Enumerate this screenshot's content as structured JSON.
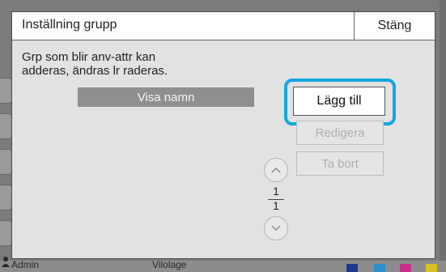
{
  "dialog": {
    "title": "Inställning grupp",
    "close_label": "Stäng",
    "description_line1": "Grp som blir anv-attr kan",
    "description_line2": "adderas, ändras lr raderas.",
    "list_header": "Visa namn"
  },
  "actions": {
    "add_label": "Lägg till",
    "edit_label": "Redigera",
    "delete_label": "Ta bort"
  },
  "pager": {
    "current_page": "1",
    "total_pages": "1"
  },
  "background": {
    "user_label": "Admin",
    "center_label": "Vilolage"
  },
  "colors": {
    "highlight": "#14a7df",
    "header_bar": "#8f8f8f"
  }
}
